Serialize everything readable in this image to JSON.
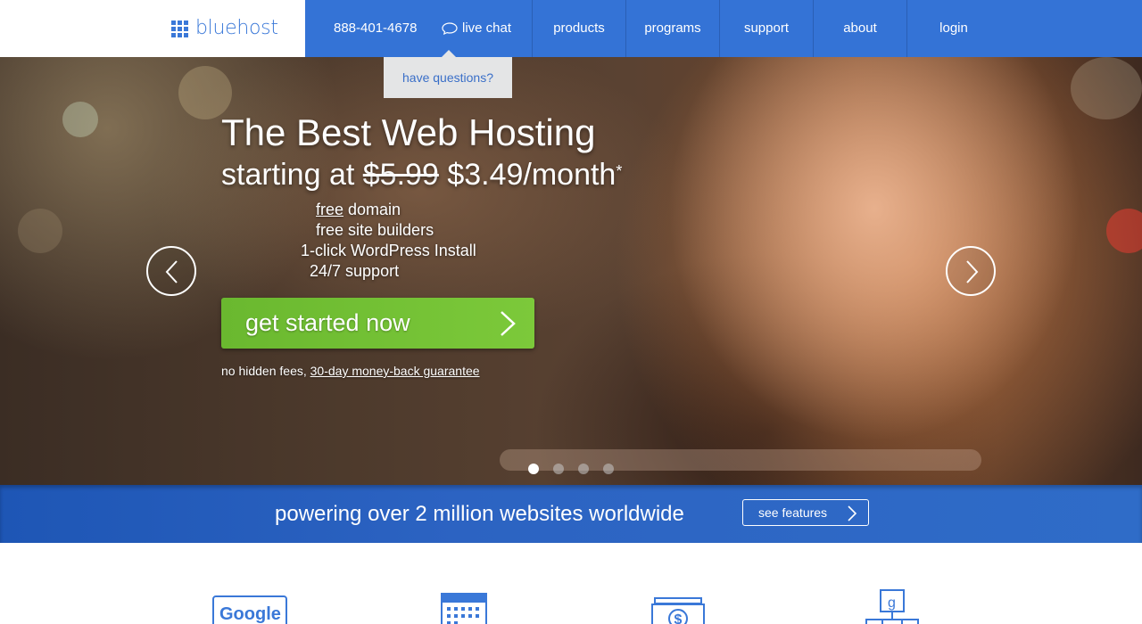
{
  "header": {
    "logo_text": "bluehost",
    "phone": "888-401-4678",
    "live_chat": "live chat",
    "nav": [
      "products",
      "programs",
      "support",
      "about",
      "login"
    ],
    "tooltip": "have questions?"
  },
  "hero": {
    "title": "The Best Web Hosting",
    "sub_prefix": "starting at",
    "old_price": "$5.99",
    "new_price": "$3.49/month",
    "asterisk": "*",
    "features": [
      {
        "underlined": "free",
        "rest": " domain"
      },
      {
        "underlined": "",
        "rest": "free site builders"
      },
      {
        "underlined": "",
        "rest": "1-click WordPress Install"
      },
      {
        "underlined": "",
        "rest": "24/7 support"
      }
    ],
    "cta_label": "get started now",
    "guarantee_prefix": "no hidden fees,",
    "guarantee_link": "30-day money-back guarantee",
    "slide_count": 4,
    "active_slide": 1
  },
  "banner": {
    "text": "powering over 2 million websites worldwide",
    "button_label": "see features"
  },
  "feature_icons": {
    "google_text": "Google",
    "icons": [
      "google-icon",
      "calendar-icon",
      "money-icon",
      "network-icon"
    ]
  },
  "colors": {
    "brand_blue": "#3473d6",
    "cta_green": "#6ab82f",
    "tooltip_bg": "#e4e5e6"
  }
}
